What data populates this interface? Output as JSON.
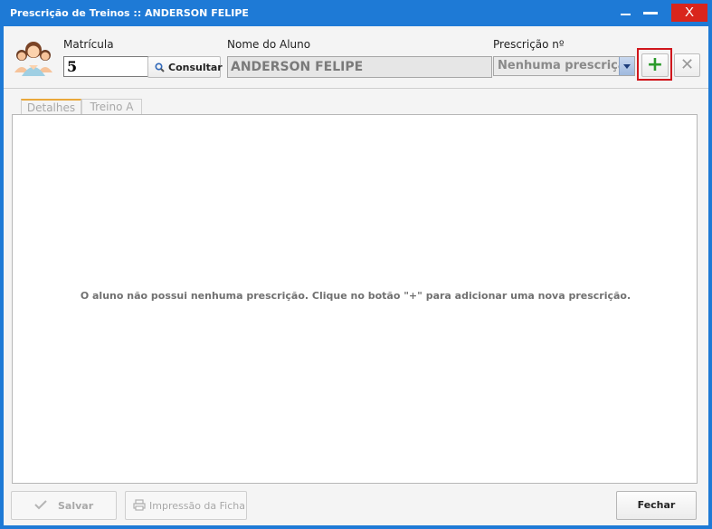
{
  "window": {
    "title": "Prescrição de Treinos  ::  ANDERSON FELIPE",
    "controls": {
      "minimize_icon": "minimize-icon",
      "maximize_icon": "maximize-icon",
      "close_label": "X"
    },
    "accent_color": "#1e7ad6",
    "close_color": "#d9251c"
  },
  "header": {
    "avatar_icon": "students-group-icon",
    "matricula_label": "Matrícula",
    "matricula_value": "5",
    "consultar_label": "Consultar",
    "nome_label": "Nome do Aluno",
    "nome_value": "ANDERSON FELIPE",
    "prescricao_label": "Prescrição nº",
    "prescricao_value": "Nenhuma prescrição",
    "add_label": "+",
    "delete_label": "✕",
    "highlight_color": "#d0161c"
  },
  "tabs": [
    {
      "label": "Detalhes"
    },
    {
      "label": "Treino A"
    }
  ],
  "content": {
    "message": "O aluno não possui nenhuma prescrição. Clique no botão \"+\" para adicionar uma nova prescrição."
  },
  "footer": {
    "salvar_label": "Salvar",
    "impressao_label": "Impressão da Ficha",
    "fechar_label": "Fechar"
  }
}
